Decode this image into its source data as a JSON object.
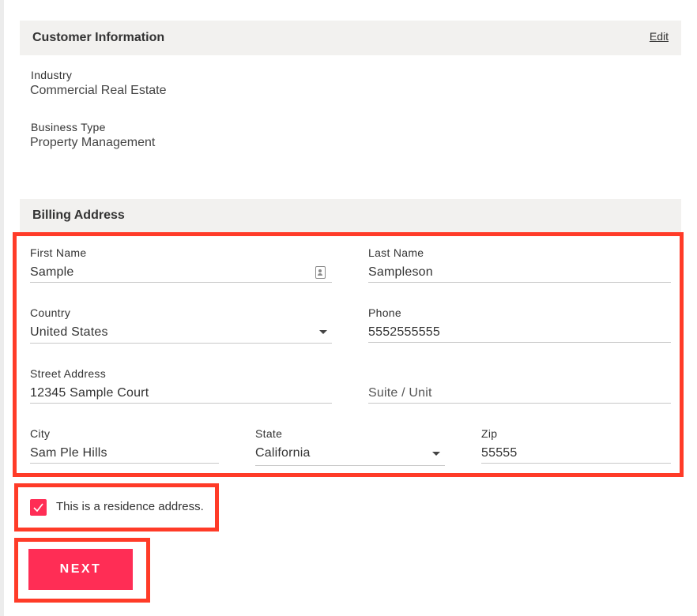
{
  "customer_info": {
    "title": "Customer Information",
    "edit_label": "Edit",
    "industry_label": "Industry",
    "industry_value": "Commercial Real Estate",
    "business_type_label": "Business Type",
    "business_type_value": "Property Management"
  },
  "billing": {
    "title": "Billing Address",
    "first_name": {
      "label": "First Name",
      "value": "Sample",
      "icon": "contact-card-icon"
    },
    "last_name": {
      "label": "Last Name",
      "value": "Sampleson"
    },
    "country": {
      "label": "Country",
      "value": "United States",
      "icon": "caret-down-icon"
    },
    "phone": {
      "label": "Phone",
      "value": "5552555555"
    },
    "street": {
      "label": "Street Address",
      "value": "12345 Sample Court"
    },
    "suite": {
      "placeholder": "Suite / Unit"
    },
    "city": {
      "label": "City",
      "value": "Sam Ple Hills"
    },
    "state": {
      "label": "State",
      "value": "California",
      "icon": "caret-down-icon"
    },
    "zip": {
      "label": "Zip",
      "value": "55555"
    }
  },
  "residence": {
    "label": "This is a residence address.",
    "checked": true
  },
  "actions": {
    "next_label": "NEXT"
  },
  "colors": {
    "accent": "#ff2d55",
    "highlight": "#ff3b28",
    "header_bg": "#f2f1ef"
  }
}
